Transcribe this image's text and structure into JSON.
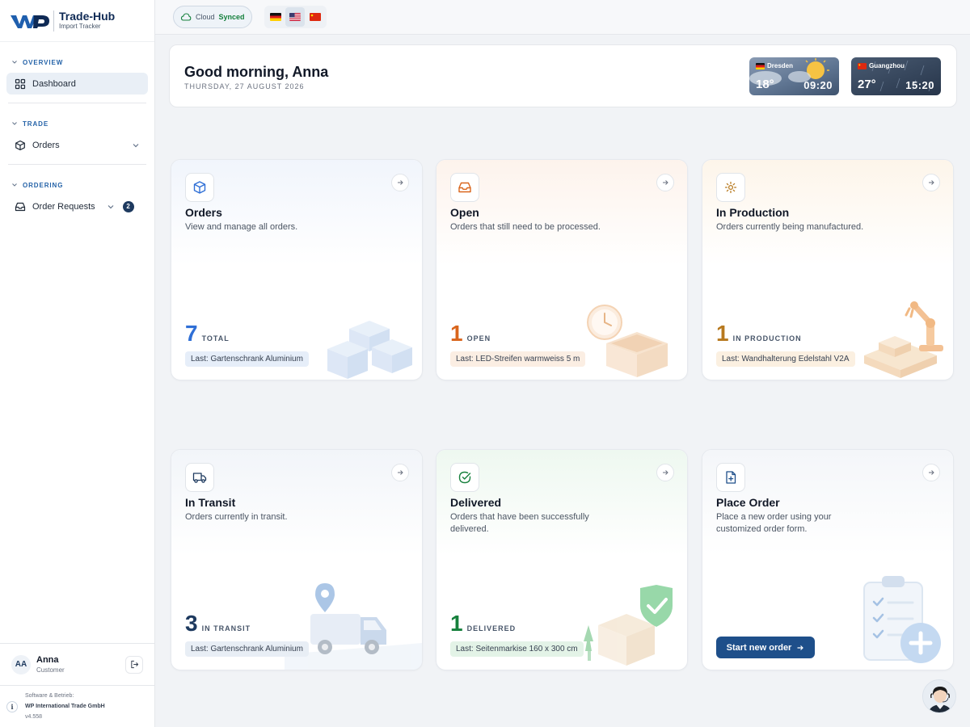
{
  "app": {
    "name": "Trade-Hub",
    "subtitle": "Import Tracker"
  },
  "sidebar": {
    "sections": [
      {
        "title": "OVERVIEW",
        "items": [
          {
            "label": "Dashboard",
            "icon": "grid-icon"
          }
        ]
      },
      {
        "title": "TRADE",
        "items": [
          {
            "label": "Orders",
            "icon": "box-icon"
          }
        ]
      },
      {
        "title": "ORDERING",
        "items": [
          {
            "label": "Order Requests",
            "icon": "inbox-icon",
            "badge": "2"
          }
        ]
      }
    ],
    "user": {
      "initials": "AA",
      "name": "Anna",
      "role": "Customer"
    },
    "footer": {
      "line1": "Software & Betrieb:",
      "company": "WP International Trade GmbH",
      "version": "v4.558"
    }
  },
  "topbar": {
    "cloud_label": "Cloud",
    "cloud_status": "Synced",
    "languages": [
      "de",
      "us",
      "cn"
    ],
    "selected_language": "us"
  },
  "greeting": {
    "title": "Good morning, Anna",
    "date": "THURSDAY, 27 AUGUST 2026"
  },
  "weather": [
    {
      "city": "Dresden",
      "temp": "18°",
      "time": "09:20"
    },
    {
      "city": "Guangzhou",
      "temp": "27°",
      "time": "15:20"
    }
  ],
  "cards": {
    "orders": {
      "title": "Orders",
      "desc": "View and manage all orders.",
      "count": "7",
      "unit": "TOTAL",
      "last": "Last: Gartenschrank Aluminium",
      "color": "#2f6fd6"
    },
    "open": {
      "title": "Open",
      "desc": "Orders that still need to be processed.",
      "count": "1",
      "unit": "OPEN",
      "last": "Last: LED-Streifen warmweiss 5 m",
      "color": "#d9651c"
    },
    "production": {
      "title": "In Production",
      "desc": "Orders currently being manufactured.",
      "count": "1",
      "unit": "IN PRODUCTION",
      "last": "Last: Wandhalterung Edelstahl V2A",
      "color": "#b7791f"
    },
    "transit": {
      "title": "In Transit",
      "desc": "Orders currently in transit.",
      "count": "3",
      "unit": "IN TRANSIT",
      "last": "Last: Gartenschrank Aluminium",
      "color": "#1e3a5f"
    },
    "delivered": {
      "title": "Delivered",
      "desc": "Orders that have been successfully delivered.",
      "count": "1",
      "unit": "DELIVERED",
      "last": "Last: Seitenmarkise 160 x 300 cm",
      "color": "#16803c"
    },
    "place": {
      "title": "Place Order",
      "desc": "Place a new order using your customized order form.",
      "button": "Start new order"
    }
  }
}
